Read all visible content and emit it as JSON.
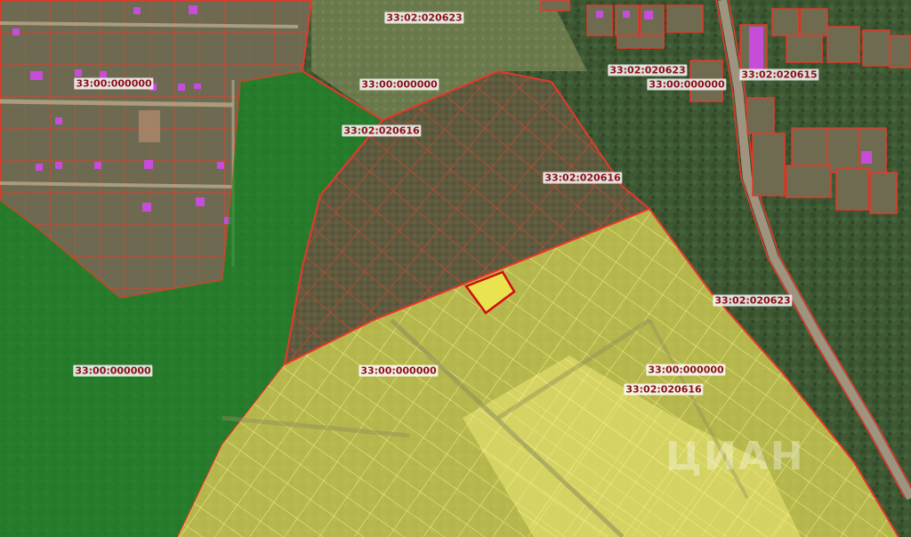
{
  "map": {
    "labels": [
      {
        "text": "33:02:020623",
        "pos": "top-center"
      },
      {
        "text": "33:00:000000",
        "pos": "top-left-settlement"
      },
      {
        "text": "33:00:000000",
        "pos": "top-center-forest"
      },
      {
        "text": "33:02:020623",
        "pos": "top-right-a"
      },
      {
        "text": "33:00:000000",
        "pos": "top-right-b"
      },
      {
        "text": "33:02:020615",
        "pos": "top-right-village"
      },
      {
        "text": "33:02:020616",
        "pos": "center-brown-top"
      },
      {
        "text": "33:02:020616",
        "pos": "center-brown-right"
      },
      {
        "text": "33:02:020623",
        "pos": "right-road"
      },
      {
        "text": "33:00:000000",
        "pos": "left-green"
      },
      {
        "text": "33:00:000000",
        "pos": "center-yellow"
      },
      {
        "text": "33:00:000000",
        "pos": "right-yellow-a"
      },
      {
        "text": "33:02:020616",
        "pos": "right-yellow-b"
      }
    ],
    "watermark": "ЦИАН",
    "colors": {
      "cadastre_line": "#e8372a",
      "selected_plot_fill": "#e9e34f",
      "selected_plot_border": "#d10d0d",
      "forest_zone": "#1f8a2a",
      "field_zone": "#f2ec6a",
      "label_text": "#8a0f1a",
      "building": "#c64dd9"
    }
  }
}
